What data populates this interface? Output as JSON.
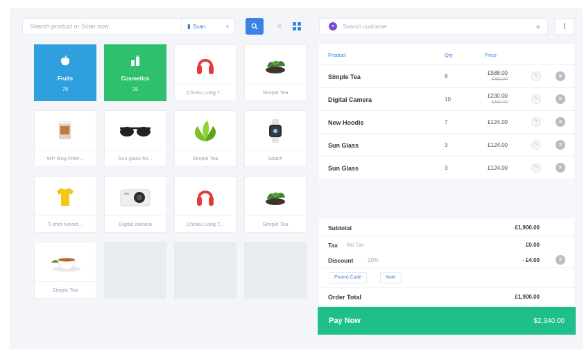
{
  "search": {
    "placeholder": "Search product or Scan now",
    "scan_label": "Scan"
  },
  "categories": [
    {
      "label": "Fruits",
      "count": "78",
      "color": "#2f9fde",
      "icon": "apple-icon"
    },
    {
      "label": "Cosmetics",
      "count": "35",
      "color": "#2fc06e",
      "icon": "cosmetics-icon"
    }
  ],
  "products": [
    {
      "name": "Chinku Long T...",
      "icon": "headphones-icon"
    },
    {
      "name": "Simple Tea",
      "icon": "tea-leaves-icon"
    },
    {
      "name": "WP Mug Filter...",
      "icon": "mug-icon"
    },
    {
      "name": "Sun glass for...",
      "icon": "sunglasses-icon"
    },
    {
      "name": "Simple Tea",
      "icon": "green-leaf-icon"
    },
    {
      "name": "Watch",
      "icon": "watch-icon"
    },
    {
      "name": "T-shirt Newst...",
      "icon": "tshirt-icon"
    },
    {
      "name": "Digital camera",
      "icon": "camera-icon"
    },
    {
      "name": "Chinku Long T...",
      "icon": "headphones-icon"
    },
    {
      "name": "Simple Tea",
      "icon": "tea-leaves-icon"
    },
    {
      "name": "Simple Tea",
      "icon": "tea-cup-icon"
    }
  ],
  "customer": {
    "placeholder": "Search customer"
  },
  "cart": {
    "headers": {
      "product": "Product",
      "qty": "Qty",
      "price": "Price"
    },
    "rows": [
      {
        "product": "Simple Tea",
        "qty": "9",
        "price": "£588.00",
        "old_price": "£760.00"
      },
      {
        "product": "Digital Camera",
        "qty": "10",
        "price": "£230.00",
        "old_price": "£450.00"
      },
      {
        "product": "New Hoodie",
        "qty": "7",
        "price": "£124.00"
      },
      {
        "product": "Sun Glass",
        "qty": "3",
        "price": "£124.00"
      },
      {
        "product": "Sun Glass",
        "qty": "3",
        "price": "£124.00"
      }
    ]
  },
  "totals": {
    "subtotal_label": "Subtotal",
    "subtotal_value": "£1,900.00",
    "tax_label": "Tax",
    "tax_note": "No Tax",
    "tax_value": "£0.00",
    "discount_label": "Discount",
    "discount_note": "20%",
    "discount_value": "- £4.00",
    "promo_label": "Promo Code",
    "note_label": "Note",
    "order_total_label": "Order Total",
    "order_total_value": "£1,900.00"
  },
  "pay": {
    "label": "Pay Now",
    "amount": "$2,340.00"
  },
  "colors": {
    "accent": "#3b82e6",
    "pay": "#1fbf8c",
    "fruits": "#2f9fde",
    "cosmetics": "#2fc06e"
  }
}
